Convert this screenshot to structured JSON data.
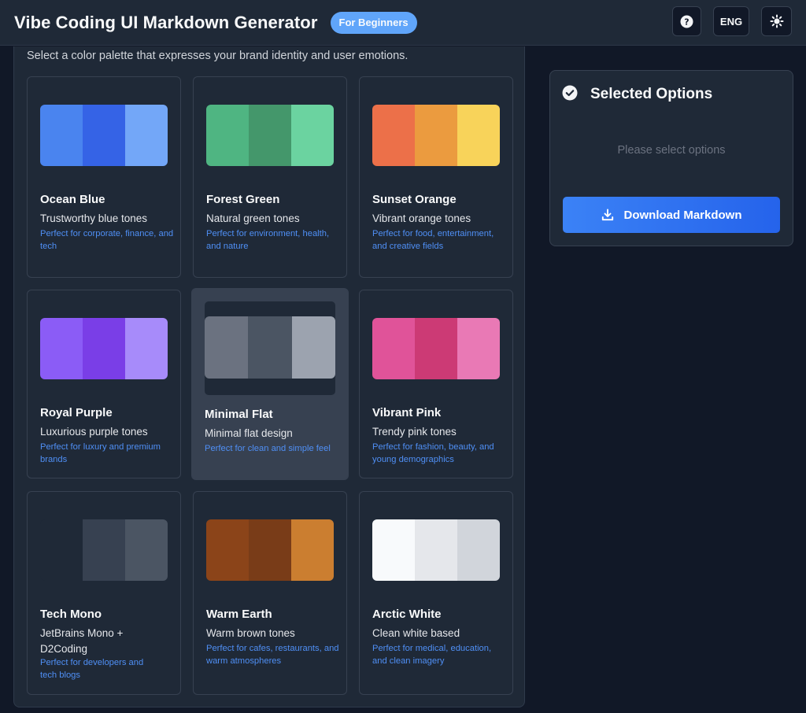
{
  "header": {
    "title": "Vibe Coding UI Markdown Generator",
    "badge": "For Beginners",
    "help_icon": "question-circle-icon",
    "language_label": "ENG",
    "theme_icon": "sun-icon"
  },
  "palette_section": {
    "description": "Select a color palette that expresses your brand identity and user emotions.",
    "cards": [
      {
        "name": "Ocean Blue",
        "subtitle": "Trustworthy blue tones",
        "use": "Perfect for corporate, finance, and tech",
        "colors": [
          "#4a84ef",
          "#3563e6",
          "#73a7f8"
        ],
        "selected": false
      },
      {
        "name": "Forest Green",
        "subtitle": "Natural green tones",
        "use": "Perfect for environment, health, and nature",
        "colors": [
          "#4fb582",
          "#44976b",
          "#6bd3a0"
        ],
        "selected": false
      },
      {
        "name": "Sunset Orange",
        "subtitle": "Vibrant orange tones",
        "use": "Perfect for food, entertainment, and creative fields",
        "colors": [
          "#ec7049",
          "#eb9b3f",
          "#f8d35a"
        ],
        "selected": false
      },
      {
        "name": "Royal Purple",
        "subtitle": "Luxurious purple tones",
        "use": "Perfect for luxury and premium brands",
        "colors": [
          "#8b5cf6",
          "#7a3ee7",
          "#a78bfa"
        ],
        "selected": false
      },
      {
        "name": "Minimal Flat",
        "subtitle": "Minimal flat design",
        "use": "Perfect for clean and simple feel",
        "colors": [
          "#6b7280",
          "#4b5563",
          "#9ca3af"
        ],
        "selected": true
      },
      {
        "name": "Vibrant Pink",
        "subtitle": "Trendy pink tones",
        "use": "Perfect for fashion, beauty, and young demographics",
        "colors": [
          "#e05399",
          "#cc3a75",
          "#e979b5"
        ],
        "selected": false
      },
      {
        "name": "Tech Mono",
        "subtitle": "JetBrains Mono + D2Coding",
        "use": "Perfect for developers and tech blogs",
        "colors": [
          "#1f2937",
          "#374151",
          "#4b5563"
        ],
        "selected": false
      },
      {
        "name": "Warm Earth",
        "subtitle": "Warm brown tones",
        "use": "Perfect for cafes, restaurants, and warm atmospheres",
        "colors": [
          "#8b4419",
          "#793c18",
          "#cb7e30"
        ],
        "selected": false
      },
      {
        "name": "Arctic White",
        "subtitle": "Clean white based",
        "use": "Perfect for medical, education, and clean imagery",
        "colors": [
          "#f8fafc",
          "#e5e7eb",
          "#d1d5db"
        ],
        "selected": false
      }
    ]
  },
  "selected_panel": {
    "title": "Selected Options",
    "check_icon": "check-circle-icon",
    "empty_text": "Please select options",
    "download_label": "Download Markdown",
    "download_icon": "download-icon"
  }
}
